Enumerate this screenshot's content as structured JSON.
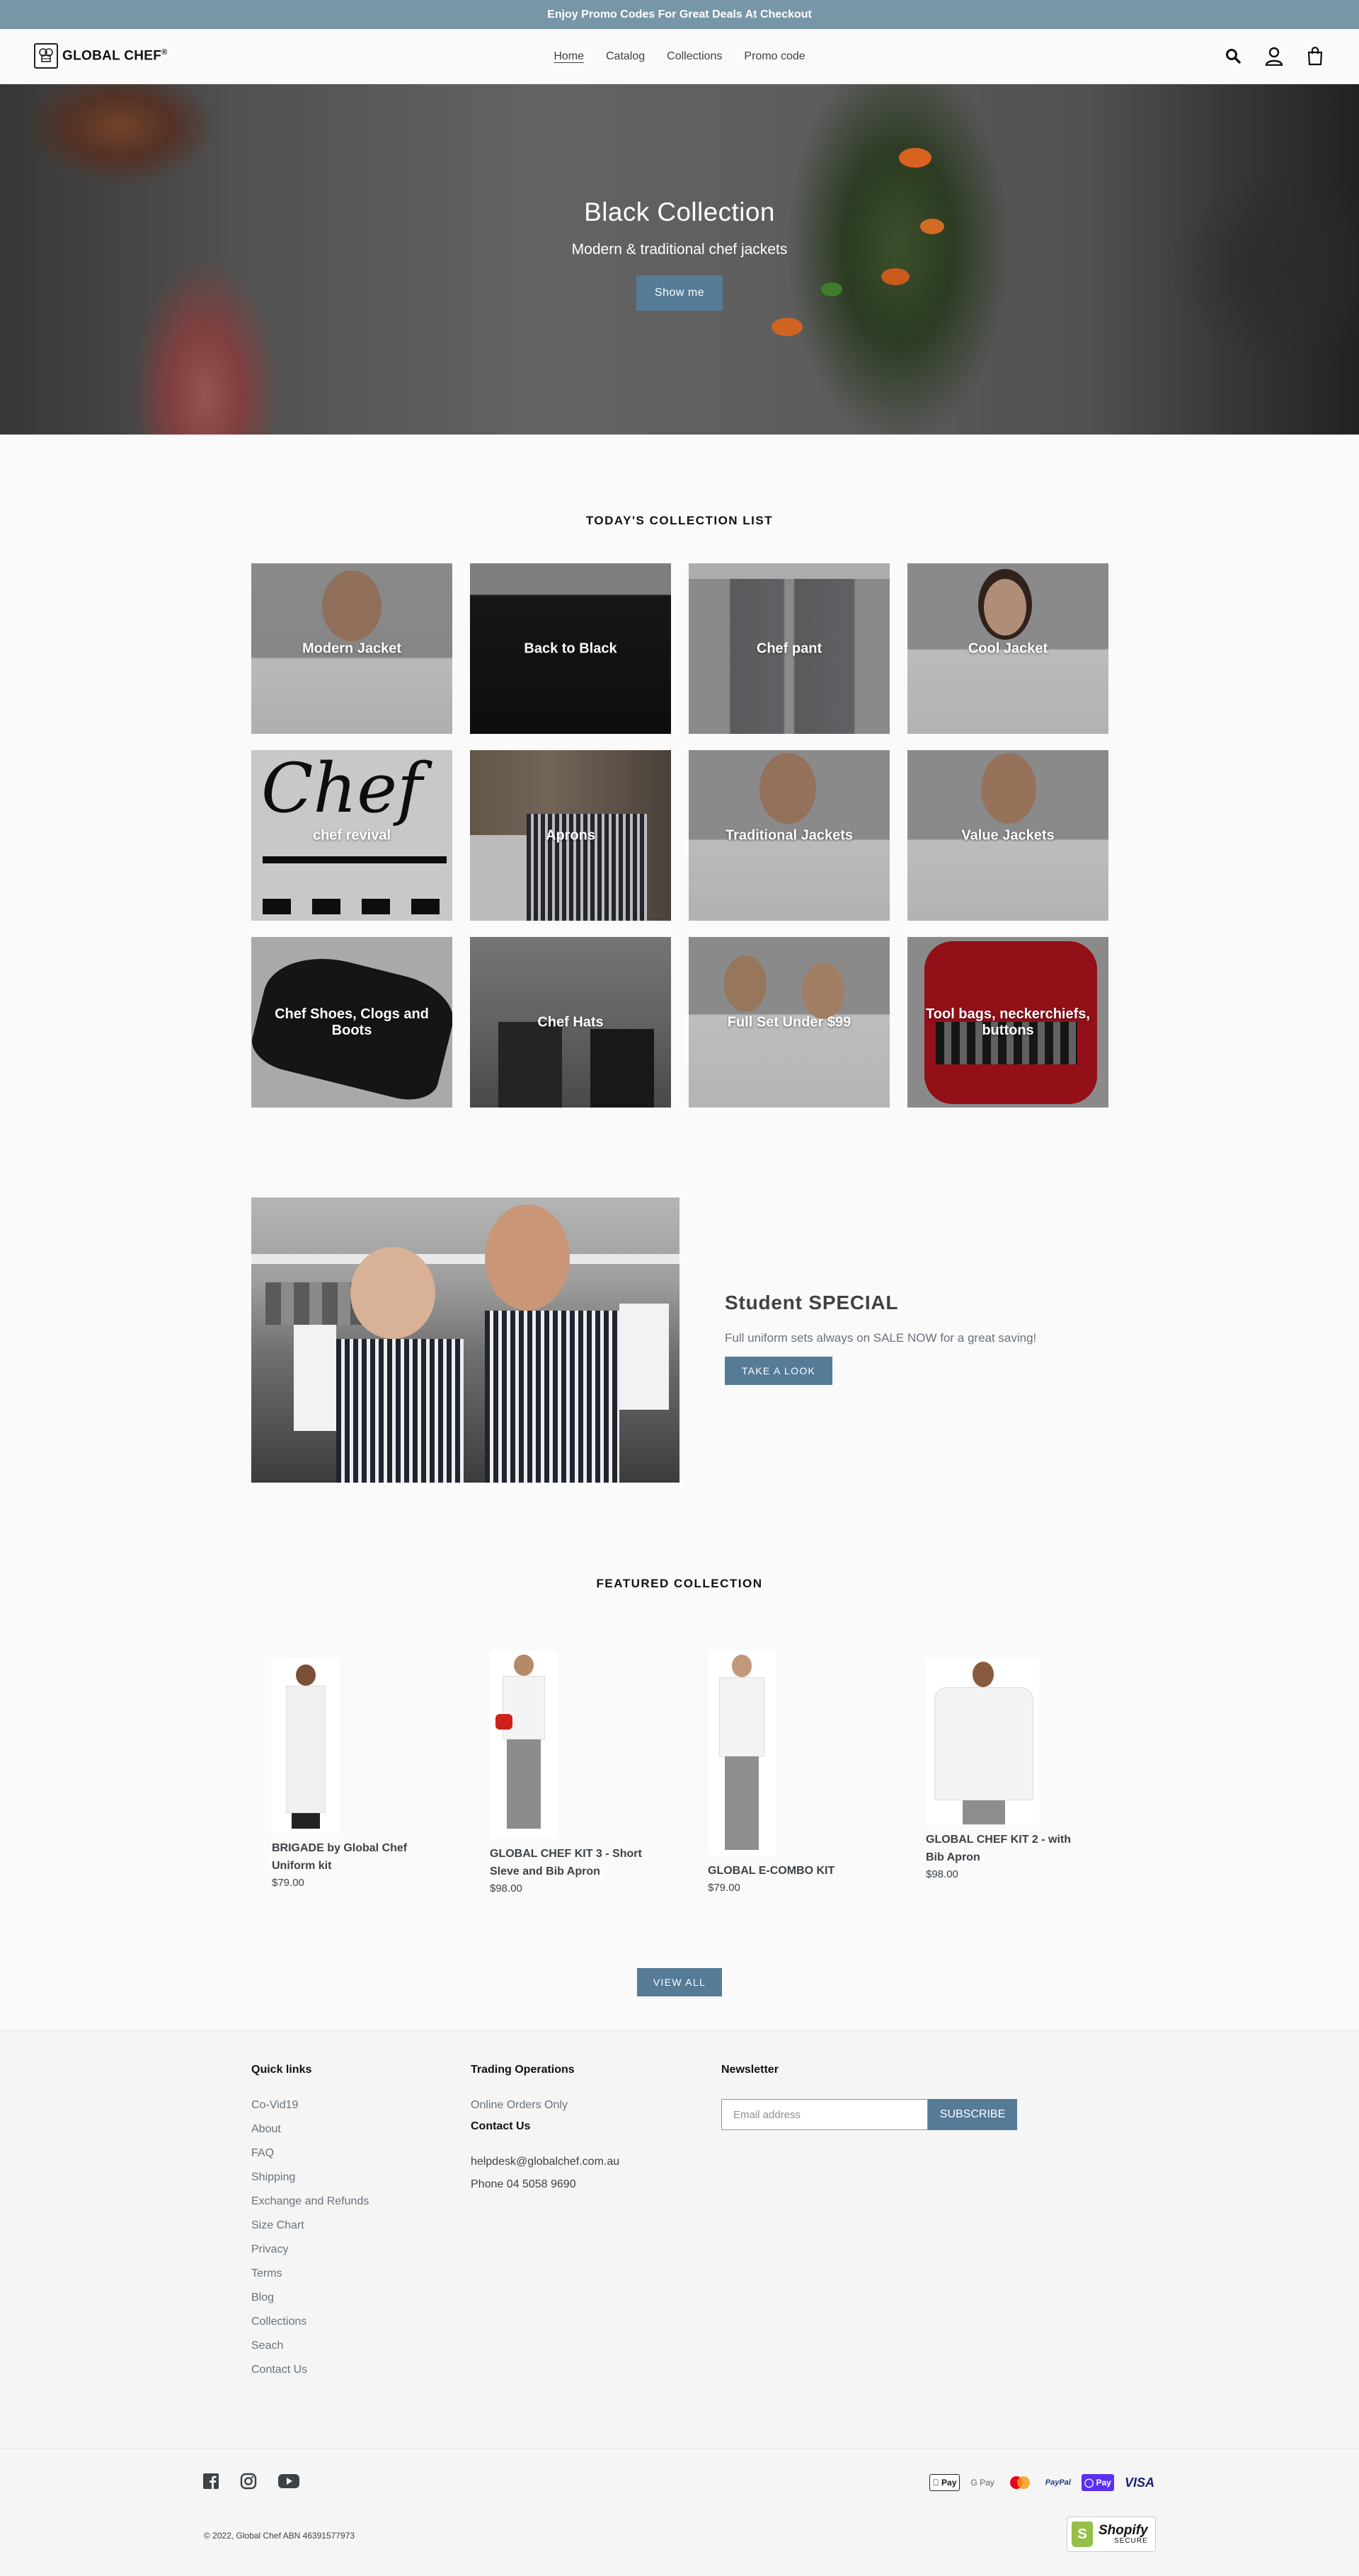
{
  "announcement": "Enjoy Promo Codes For Great Deals At Checkout",
  "brand": {
    "name": "GLOBAL CHEF",
    "reg": "®"
  },
  "nav": [
    {
      "label": "Home",
      "active": true
    },
    {
      "label": "Catalog"
    },
    {
      "label": "Collections"
    },
    {
      "label": "Promo code"
    }
  ],
  "header_icons": [
    "search-icon",
    "account-icon",
    "cart-icon"
  ],
  "hero": {
    "title": "Black Collection",
    "subtitle": "Modern & traditional chef jackets",
    "button": "Show me"
  },
  "collections": {
    "title": "TODAY'S COLLECTION LIST",
    "items": [
      {
        "label": "Modern Jacket"
      },
      {
        "label": "Back to Black"
      },
      {
        "label": "Chef pant"
      },
      {
        "label": "Cool Jacket"
      },
      {
        "label": "chef revival",
        "logo_text": "Chef"
      },
      {
        "label": "Aprons"
      },
      {
        "label": "Traditional Jackets"
      },
      {
        "label": "Value Jackets"
      },
      {
        "label": "Chef Shoes, Clogs and Boots"
      },
      {
        "label": "Chef Hats"
      },
      {
        "label": "Full Set Under $99"
      },
      {
        "label": "Tool bags, neckerchiefs, buttons"
      }
    ]
  },
  "student": {
    "title": "Student SPECIAL",
    "text": "Full uniform sets always on SALE NOW for a great saving!",
    "button": "TAKE A LOOK"
  },
  "featured": {
    "title": "FEATURED COLLECTION",
    "products": [
      {
        "name": "BRIGADE by Global Chef Uniform kit",
        "price": "$79.00"
      },
      {
        "name": "GLOBAL CHEF KIT 3 - Short Sleve and Bib Apron",
        "price": "$98.00"
      },
      {
        "name": "GLOBAL E-COMBO KIT",
        "price": "$79.00"
      },
      {
        "name": "GLOBAL CHEF KIT 2 - with Bib Apron",
        "price": "$98.00"
      }
    ],
    "view_all": "VIEW ALL"
  },
  "footer": {
    "quick_links": {
      "title": "Quick links",
      "items": [
        "Co-Vid19",
        "About",
        "FAQ",
        "Shipping",
        "Exchange and Refunds",
        "Size Chart",
        "Privacy",
        "Terms",
        "Blog",
        "Collections",
        "Seach",
        "Contact Us"
      ]
    },
    "trading": {
      "title": "Trading Operations",
      "text": "Online Orders Only",
      "contact_title": "Contact Us",
      "email": "helpdesk@globalchef.com.au",
      "phone": "Phone 04 5058 9690"
    },
    "newsletter": {
      "title": "Newsletter",
      "placeholder": "Email address",
      "button": "SUBSCRIBE"
    },
    "social": [
      "facebook-icon",
      "instagram-icon",
      "youtube-icon"
    ],
    "payments": [
      "Pay",
      "G Pay",
      "PayPal",
      "Pay",
      "VISA"
    ],
    "copyright": "© 2022, Global Chef ABN 46391577973",
    "shopify": {
      "name": "Shopify",
      "secure": "SECURE"
    },
    "colors": {
      "accent": "#557b97",
      "announcement": "#7796a8"
    }
  }
}
